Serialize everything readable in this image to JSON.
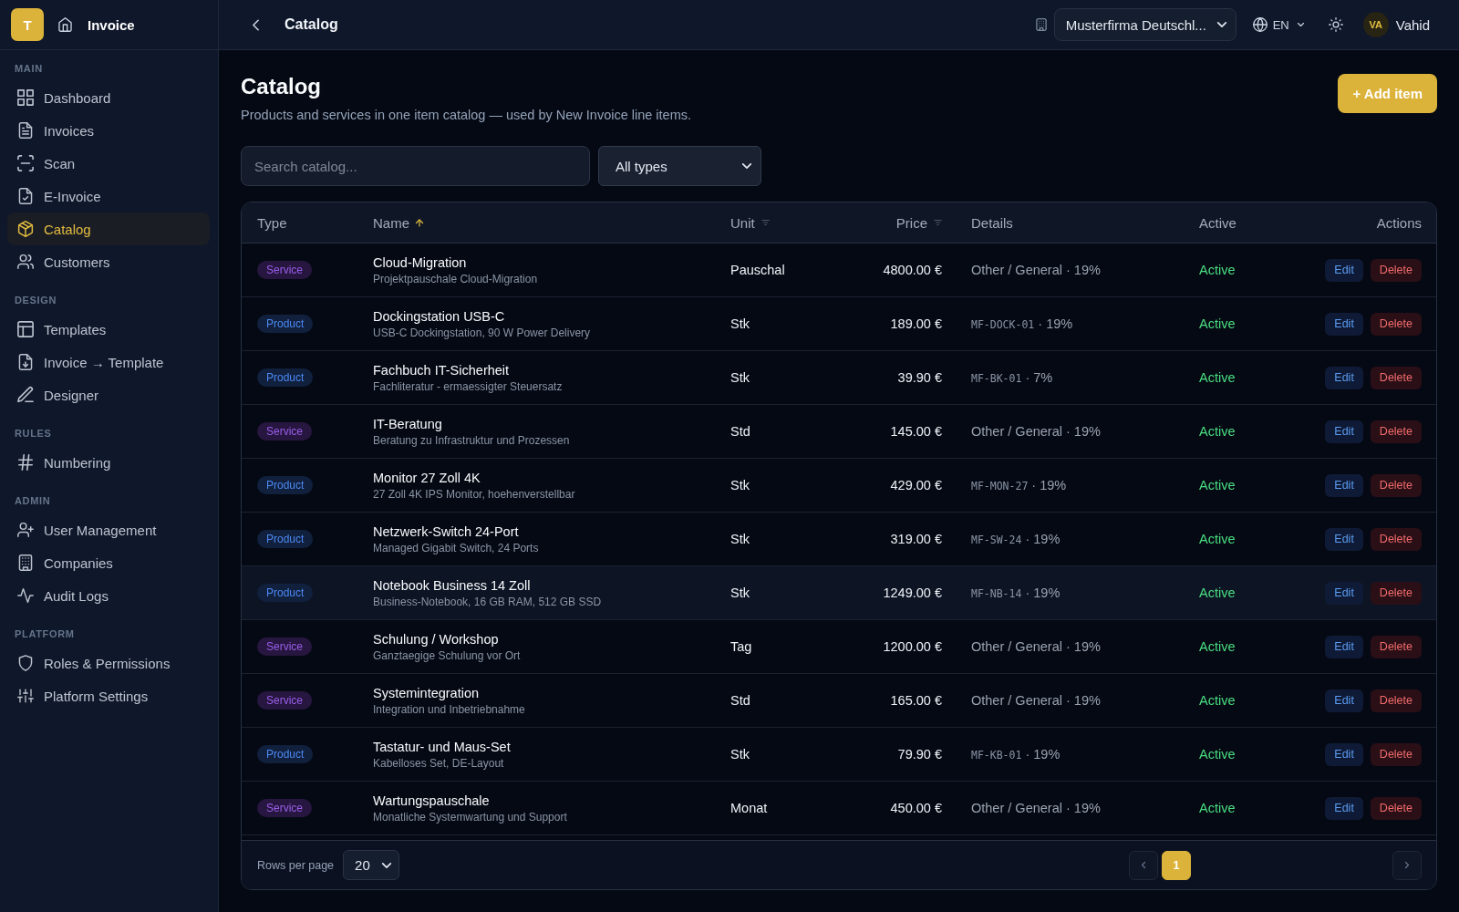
{
  "sidebar": {
    "brand": {
      "logo": "T",
      "title": "Invoice"
    },
    "sections": [
      {
        "label": "MAIN",
        "items": [
          {
            "label": "Dashboard",
            "selected": false
          },
          {
            "label": "Invoices",
            "selected": false
          },
          {
            "label": "Scan",
            "selected": false
          },
          {
            "label": "E-Invoice",
            "selected": false
          },
          {
            "label": "Catalog",
            "selected": true
          },
          {
            "label": "Customers",
            "selected": false
          }
        ]
      },
      {
        "label": "DESIGN",
        "items": [
          {
            "label": "Templates",
            "selected": false
          },
          {
            "label": "Invoice → Template",
            "selected": false
          },
          {
            "label": "Designer",
            "selected": false
          }
        ]
      },
      {
        "label": "RULES",
        "items": [
          {
            "label": "Numbering",
            "selected": false
          }
        ]
      },
      {
        "label": "ADMIN",
        "items": [
          {
            "label": "User Management",
            "selected": false
          },
          {
            "label": "Companies",
            "selected": false
          },
          {
            "label": "Audit Logs",
            "selected": false
          }
        ]
      },
      {
        "label": "PLATFORM",
        "items": [
          {
            "label": "Roles & Permissions",
            "selected": false
          },
          {
            "label": "Platform Settings",
            "selected": false
          }
        ]
      }
    ]
  },
  "header": {
    "title": "Catalog",
    "company": "Musterfirma Deutschl...",
    "language": "EN",
    "user": {
      "initials": "VA",
      "name": "Vahid"
    }
  },
  "page": {
    "title": "Catalog",
    "subtitle": "Products and services in one item catalog — used by New Invoice line items.",
    "add_button": "+ Add item"
  },
  "filters": {
    "search": {
      "placeholder": "Search catalog..."
    },
    "type_select": "All types"
  },
  "table": {
    "columns": [
      {
        "label": "Type"
      },
      {
        "label": "Name",
        "sorted": true
      },
      {
        "label": "Unit",
        "sorted": false
      },
      {
        "label": "Price",
        "sorted": false
      },
      {
        "label": "Details"
      },
      {
        "label": "Active"
      },
      {
        "label": "Actions"
      }
    ],
    "rows": [
      {
        "type": {
          "label": "Service",
          "color": "#27163f"
        },
        "name": "Cloud-Migration",
        "description": "Projektpauschale Cloud-Migration",
        "unit": "Pauschal",
        "price": "4800.00 €",
        "details": {
          "text": "Other / General · 19%"
        },
        "status": "Active",
        "active": true,
        "actions": [
          "Edit",
          "Delete"
        ],
        "hovered": false
      },
      {
        "type": {
          "label": "Product",
          "color": "#10203d"
        },
        "name": "Dockingstation USB-C",
        "description": "USB-C Dockingstation, 90 W Power Delivery",
        "unit": "Stk",
        "price": "189.00 €",
        "details": {
          "code": "MF-DOCK-01",
          "text": "· 19%"
        },
        "status": "Active",
        "active": true,
        "actions": [
          "Edit",
          "Delete"
        ],
        "hovered": false
      },
      {
        "type": {
          "label": "Product",
          "color": "#10203d"
        },
        "name": "Fachbuch IT-Sicherheit",
        "description": "Fachliteratur - ermaessigter Steuersatz",
        "unit": "Stk",
        "price": "39.90 €",
        "details": {
          "code": "MF-BK-01",
          "text": "· 7%"
        },
        "status": "Active",
        "active": true,
        "actions": [
          "Edit",
          "Delete"
        ],
        "hovered": false
      },
      {
        "type": {
          "label": "Service",
          "color": "#27163f"
        },
        "name": "IT-Beratung",
        "description": "Beratung zu Infrastruktur und Prozessen",
        "unit": "Std",
        "price": "145.00 €",
        "details": {
          "text": "Other / General · 19%"
        },
        "status": "Active",
        "active": true,
        "actions": [
          "Edit",
          "Delete"
        ],
        "hovered": false
      },
      {
        "type": {
          "label": "Product",
          "color": "#10203d"
        },
        "name": "Monitor 27 Zoll 4K",
        "description": "27 Zoll 4K IPS Monitor, hoehenverstellbar",
        "unit": "Stk",
        "price": "429.00 €",
        "details": {
          "code": "MF-MON-27",
          "text": "· 19%"
        },
        "status": "Active",
        "active": true,
        "actions": [
          "Edit",
          "Delete"
        ],
        "hovered": false
      },
      {
        "type": {
          "label": "Product",
          "color": "#10203d"
        },
        "name": "Netzwerk-Switch 24-Port",
        "description": "Managed Gigabit Switch, 24 Ports",
        "unit": "Stk",
        "price": "319.00 €",
        "details": {
          "code": "MF-SW-24",
          "text": "· 19%"
        },
        "status": "Active",
        "active": true,
        "actions": [
          "Edit",
          "Delete"
        ],
        "hovered": false
      },
      {
        "type": {
          "label": "Product",
          "color": "#10203d"
        },
        "name": "Notebook Business 14 Zoll",
        "description": "Business-Notebook, 16 GB RAM, 512 GB SSD",
        "unit": "Stk",
        "price": "1249.00 €",
        "details": {
          "code": "MF-NB-14",
          "text": "· 19%"
        },
        "status": "Active",
        "active": true,
        "actions": [
          "Edit",
          "Delete"
        ],
        "hovered": true
      },
      {
        "type": {
          "label": "Service",
          "color": "#27163f"
        },
        "name": "Schulung / Workshop",
        "description": "Ganztaegige Schulung vor Ort",
        "unit": "Tag",
        "price": "1200.00 €",
        "details": {
          "text": "Other / General · 19%"
        },
        "status": "Active",
        "active": true,
        "actions": [
          "Edit",
          "Delete"
        ],
        "hovered": false
      },
      {
        "type": {
          "label": "Service",
          "color": "#27163f"
        },
        "name": "Systemintegration",
        "description": "Integration und Inbetriebnahme",
        "unit": "Std",
        "price": "165.00 €",
        "details": {
          "text": "Other / General · 19%"
        },
        "status": "Active",
        "active": true,
        "actions": [
          "Edit",
          "Delete"
        ],
        "hovered": false
      },
      {
        "type": {
          "label": "Product",
          "color": "#10203d"
        },
        "name": "Tastatur- und Maus-Set",
        "description": "Kabelloses Set, DE-Layout",
        "unit": "Stk",
        "price": "79.90 €",
        "details": {
          "code": "MF-KB-01",
          "text": "· 19%"
        },
        "status": "Active",
        "active": true,
        "actions": [
          "Edit",
          "Delete"
        ],
        "hovered": false
      },
      {
        "type": {
          "label": "Service",
          "color": "#27163f"
        },
        "name": "Wartungspauschale",
        "description": "Monatliche Systemwartung und Support",
        "unit": "Monat",
        "price": "450.00 €",
        "details": {
          "text": "Other / General · 19%"
        },
        "status": "Active",
        "active": true,
        "actions": [
          "Edit",
          "Delete"
        ],
        "hovered": false
      }
    ],
    "footer": {
      "rows_per_page_label": "Rows per page",
      "rows_per_page": "20",
      "pages": [
        {
          "label": "1",
          "selected": true
        }
      ]
    }
  }
}
